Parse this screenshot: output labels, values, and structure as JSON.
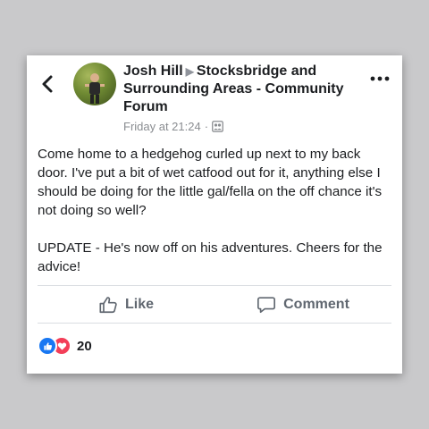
{
  "post": {
    "author": "Josh Hill",
    "group": "Stocksbridge and Surrounding Areas - Community Forum",
    "timestamp": "Friday at 21:24",
    "privacy_icon": "group-members-icon",
    "paragraphs": [
      "Come home to a hedgehog curled up next to my back door. I've put a bit of wet catfood out for it, anything else I should be doing for the little gal/fella on the off chance it's not doing so well?",
      "UPDATE - He's now off on his adventures. Cheers for the advice!"
    ]
  },
  "actions": {
    "like_label": "Like",
    "comment_label": "Comment"
  },
  "reactions": {
    "icons": [
      "like-reaction-icon",
      "love-reaction-icon"
    ],
    "count": "20"
  },
  "colors": {
    "background": "#c9c9cb",
    "facebook_blue": "#1877f2",
    "love_red": "#f33e58",
    "text": "#1c1e21",
    "muted": "#8a8d91"
  }
}
